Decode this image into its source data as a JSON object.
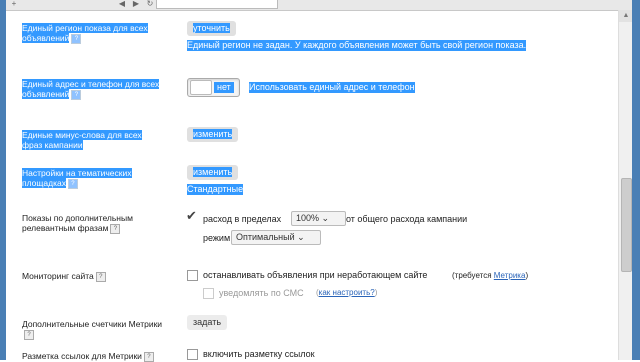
{
  "browser": {
    "controls": [
      "+",
      "◀",
      "▶",
      "↻"
    ]
  },
  "rows": {
    "region": {
      "label": "Единый регион показа для всех объявлений",
      "help": "?",
      "button": "уточнить",
      "note": "Единый регион не задан. У каждого объявления может быть свой регион показа."
    },
    "address": {
      "label": "Единый адрес и телефон для всех объявлений",
      "help": "?",
      "toggle_state": "нет",
      "toggle_label": "Использовать единый адрес и телефон"
    },
    "minus_words": {
      "label": "Единые минус-слова для всех фраз кампании",
      "button": "изменить"
    },
    "thematic": {
      "label": "Настройки на тематических площадках",
      "help": "?",
      "button": "изменить",
      "value": "Стандартные"
    },
    "extra_phrases": {
      "label": "Показы по дополнительным релевантным фразам",
      "help": "?",
      "checked": true,
      "spend_prefix": "расход в пределах",
      "spend_value": "100%",
      "spend_suffix": "от общего расхода кампании",
      "mode_label": "режим",
      "mode_value": "Оптимальный"
    },
    "monitoring": {
      "label": "Мониторинг сайта",
      "help": "?",
      "checkbox_label": "останавливать объявления при неработающем сайте",
      "requires_prefix": "(требуется",
      "requires_link": "Метрика",
      "requires_suffix": ")",
      "sms_label": "уведомлять по СМС",
      "sms_paren_open": "(",
      "sms_link": "как настроить?",
      "sms_paren_close": ")"
    },
    "counters": {
      "label": "Дополнительные счетчики Метрики",
      "help": "?",
      "button": "задать"
    },
    "utm": {
      "label": "Разметка ссылок для Метрики",
      "help": "?",
      "checkbox_label": "включить разметку ссылок"
    }
  }
}
